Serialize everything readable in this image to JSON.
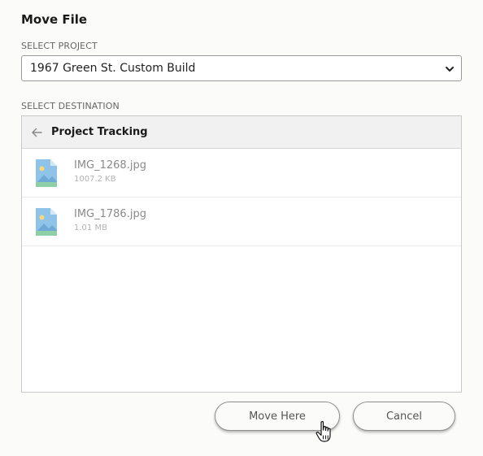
{
  "dialog": {
    "title": "Move File"
  },
  "project": {
    "label": "SELECT PROJECT",
    "selected": "1967 Green St. Custom Build"
  },
  "destination": {
    "label": "SELECT DESTINATION",
    "folder": "Project Tracking",
    "files": [
      {
        "name": "IMG_1268.jpg",
        "size": "1007.2 KB",
        "icon": "image-file-icon"
      },
      {
        "name": "IMG_1786.jpg",
        "size": "1.01 MB",
        "icon": "image-file-icon"
      }
    ]
  },
  "actions": {
    "move_label": "Move Here",
    "cancel_label": "Cancel"
  },
  "colors": {
    "background": "#fbfbf9",
    "header_bg": "#f1f1f1",
    "icon_blue": "#8fc3e8",
    "icon_green": "#8fcfa8",
    "icon_sun": "#f6d97a"
  }
}
